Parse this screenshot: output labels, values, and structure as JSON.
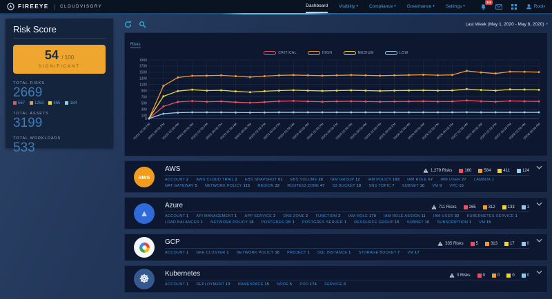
{
  "header": {
    "brand": "FIREEYE",
    "divider": "|",
    "product": "CLOUDVISORY",
    "caret": "▾",
    "nav": [
      {
        "label": "Dashboard"
      },
      {
        "label": "Visibility"
      },
      {
        "label": "Compliance"
      },
      {
        "label": "Governance"
      },
      {
        "label": "Settings"
      }
    ],
    "notification_count": "340",
    "user_label": "Root"
  },
  "toolbar": {
    "date_range": "Last Week (May 1, 2020 - May 8, 2020)"
  },
  "sidebar": {
    "title": "Risk Score",
    "score": "54",
    "score_max": "/ 100",
    "score_level": "SIGNIFICANT",
    "stats": [
      {
        "label": "TOTAL RISKS",
        "value": "2669",
        "badges": [
          {
            "value": "567"
          },
          {
            "value": "1253"
          },
          {
            "value": "665"
          },
          {
            "value": "184"
          }
        ]
      },
      {
        "label": "TOTAL ASSETS",
        "value": "3199"
      },
      {
        "label": "TOTAL WORKLOADS",
        "value": "533"
      }
    ]
  },
  "severity_colors": [
    "#ef4f63",
    "#f39c2d",
    "#f2d430",
    "#93cdee"
  ],
  "accent_colors": {
    "score_box": "#efa62f",
    "link_blue": "#3e8ed6",
    "stat_blue": "#3e7cb8",
    "icon_cyan": "#2bb3e0"
  },
  "chart_data": {
    "type": "line",
    "title": "Risks",
    "legend_position": "top",
    "grid": true,
    "ylim": [
      0,
      1900
    ],
    "yticks": [
      0,
      100,
      300,
      500,
      700,
      900,
      1100,
      1300,
      1500,
      1700,
      1900
    ],
    "x": [
      "05/01 02:58 PM",
      "05/01 08:58 PM",
      "05/02 02:58 AM",
      "05/02 08:58 AM",
      "05/02 02:58 PM",
      "05/02 08:58 PM",
      "05/03 02:58 AM",
      "05/03 08:58 AM",
      "05/03 02:58 PM",
      "05/03 08:58 PM",
      "05/04 02:58 AM",
      "05/04 08:58 AM",
      "05/04 02:58 PM",
      "05/04 08:58 PM",
      "05/05 02:58 AM",
      "05/05 08:58 AM",
      "05/05 02:58 PM",
      "05/05 08:58 PM",
      "05/06 02:58 AM",
      "05/06 08:58 AM",
      "05/06 02:58 PM",
      "05/06 08:58 PM",
      "05/07 02:58 AM",
      "05/07 08:58 AM",
      "05/07 02:58 PM",
      "05/07 08:58 PM",
      "05/08 02:58 AM",
      "05/08 08:58 AM"
    ],
    "series": [
      {
        "name": "CRITICAL",
        "color": "#ef4f63",
        "values": [
          0,
          390,
          540,
          565,
          545,
          555,
          530,
          510,
          535,
          560,
          570,
          555,
          545,
          555,
          560,
          550,
          545,
          550,
          555,
          560,
          550,
          555,
          585,
          560,
          545,
          570,
          560,
          555
        ]
      },
      {
        "name": "HIGH",
        "color": "#f39c2d",
        "values": [
          0,
          1060,
          1330,
          1385,
          1390,
          1400,
          1375,
          1345,
          1375,
          1400,
          1410,
          1400,
          1390,
          1400,
          1410,
          1400,
          1390,
          1400,
          1410,
          1420,
          1405,
          1415,
          1545,
          1495,
          1460,
          1520,
          1515,
          1505
        ]
      },
      {
        "name": "MEDIUM",
        "color": "#f2d430",
        "values": [
          0,
          720,
          890,
          935,
          905,
          915,
          880,
          855,
          885,
          905,
          920,
          905,
          895,
          905,
          915,
          905,
          895,
          905,
          910,
          915,
          905,
          910,
          955,
          925,
          905,
          945,
          940,
          930
        ]
      },
      {
        "name": "LOW",
        "color": "#93cdee",
        "values": [
          0,
          155,
          190,
          200,
          200,
          200,
          195,
          192,
          196,
          200,
          200,
          200,
          200,
          200,
          200,
          200,
          200,
          200,
          200,
          200,
          200,
          200,
          205,
          200,
          200,
          200,
          200,
          200
        ]
      }
    ]
  },
  "sections": [
    {
      "id": "aws",
      "name": "AWS",
      "icon_text": "aws",
      "risks_label": "1,279 Risks",
      "badges": [
        "160",
        "584",
        "411",
        "124"
      ],
      "links": [
        {
          "label": "ACCOUNT",
          "count": "2"
        },
        {
          "label": "AWS CLOUD TRAIL",
          "count": "2"
        },
        {
          "label": "EBS SNAPSHOT",
          "count": "61"
        },
        {
          "label": "EBS VOLUME",
          "count": "28"
        },
        {
          "label": "IAM GROUP",
          "count": "12"
        },
        {
          "label": "IAM POLICY",
          "count": "193"
        },
        {
          "label": "IAM ROLE",
          "count": "67"
        },
        {
          "label": "IAM USER",
          "count": "27"
        },
        {
          "label": "LAMBDA",
          "count": "1"
        },
        {
          "label": "NAT GATEWAY",
          "count": "5"
        },
        {
          "label": "NETWORK POLICY",
          "count": "115"
        },
        {
          "label": "REGION",
          "count": "32"
        },
        {
          "label": "ROUTE53 ZONE",
          "count": "47"
        },
        {
          "label": "S3 BUCKET",
          "count": "18"
        },
        {
          "label": "SNS TOPIC",
          "count": "7"
        },
        {
          "label": "SUBNET",
          "count": "16"
        },
        {
          "label": "VM",
          "count": "9"
        },
        {
          "label": "VPC",
          "count": "16"
        }
      ]
    },
    {
      "id": "azure",
      "name": "Azure",
      "icon_text": "▲",
      "risks_label": "711 Risks",
      "badges": [
        "265",
        "312",
        "133",
        "1"
      ],
      "links": [
        {
          "label": "ACCOUNT",
          "count": "1"
        },
        {
          "label": "API MANAGEMENT",
          "count": "1"
        },
        {
          "label": "APP SERVICE",
          "count": "2"
        },
        {
          "label": "DNS ZONE",
          "count": "2"
        },
        {
          "label": "FUNCTION",
          "count": "2"
        },
        {
          "label": "IAM ROLE",
          "count": "170"
        },
        {
          "label": "IAM ROLE ASSIGN",
          "count": "11"
        },
        {
          "label": "IAM USER",
          "count": "32"
        },
        {
          "label": "KUBERNETES SERVICE",
          "count": "1"
        },
        {
          "label": "LOAD BALANCER",
          "count": "1"
        },
        {
          "label": "NETWORK POLICY",
          "count": "18"
        },
        {
          "label": "POSTGRES DB",
          "count": "1"
        },
        {
          "label": "POSTGRES SERVER",
          "count": "1"
        },
        {
          "label": "RESOURCE GROUP",
          "count": "15"
        },
        {
          "label": "SUBNET",
          "count": "10"
        },
        {
          "label": "SUBSCRIPTION",
          "count": "1"
        },
        {
          "label": "VM",
          "count": "15"
        }
      ]
    },
    {
      "id": "gcp",
      "name": "GCP",
      "icon_text": "",
      "risks_label": "335 Risks",
      "badges": [
        "5",
        "313",
        "17",
        "0"
      ],
      "links": [
        {
          "label": "ACCOUNT",
          "count": "1"
        },
        {
          "label": "GKE CLUSTER",
          "count": "1"
        },
        {
          "label": "NETWORK POLICY",
          "count": "16"
        },
        {
          "label": "PROJECT",
          "count": "1"
        },
        {
          "label": "SQL INSTANCE",
          "count": "1"
        },
        {
          "label": "STORAGE BUCKET",
          "count": "7"
        },
        {
          "label": "VM",
          "count": "17"
        }
      ]
    },
    {
      "id": "k8s",
      "name": "Kubernetes",
      "icon_text": "☸",
      "risks_label": "0 Risks",
      "badges": [
        "0",
        "0",
        "0",
        "0"
      ],
      "links": [
        {
          "label": "ACCOUNT",
          "count": "1"
        },
        {
          "label": "DEPLOYMENT",
          "count": "13"
        },
        {
          "label": "NAMESPACE",
          "count": "15"
        },
        {
          "label": "NODE",
          "count": "5"
        },
        {
          "label": "POD",
          "count": "174"
        },
        {
          "label": "SERVICE",
          "count": "6"
        }
      ]
    }
  ]
}
